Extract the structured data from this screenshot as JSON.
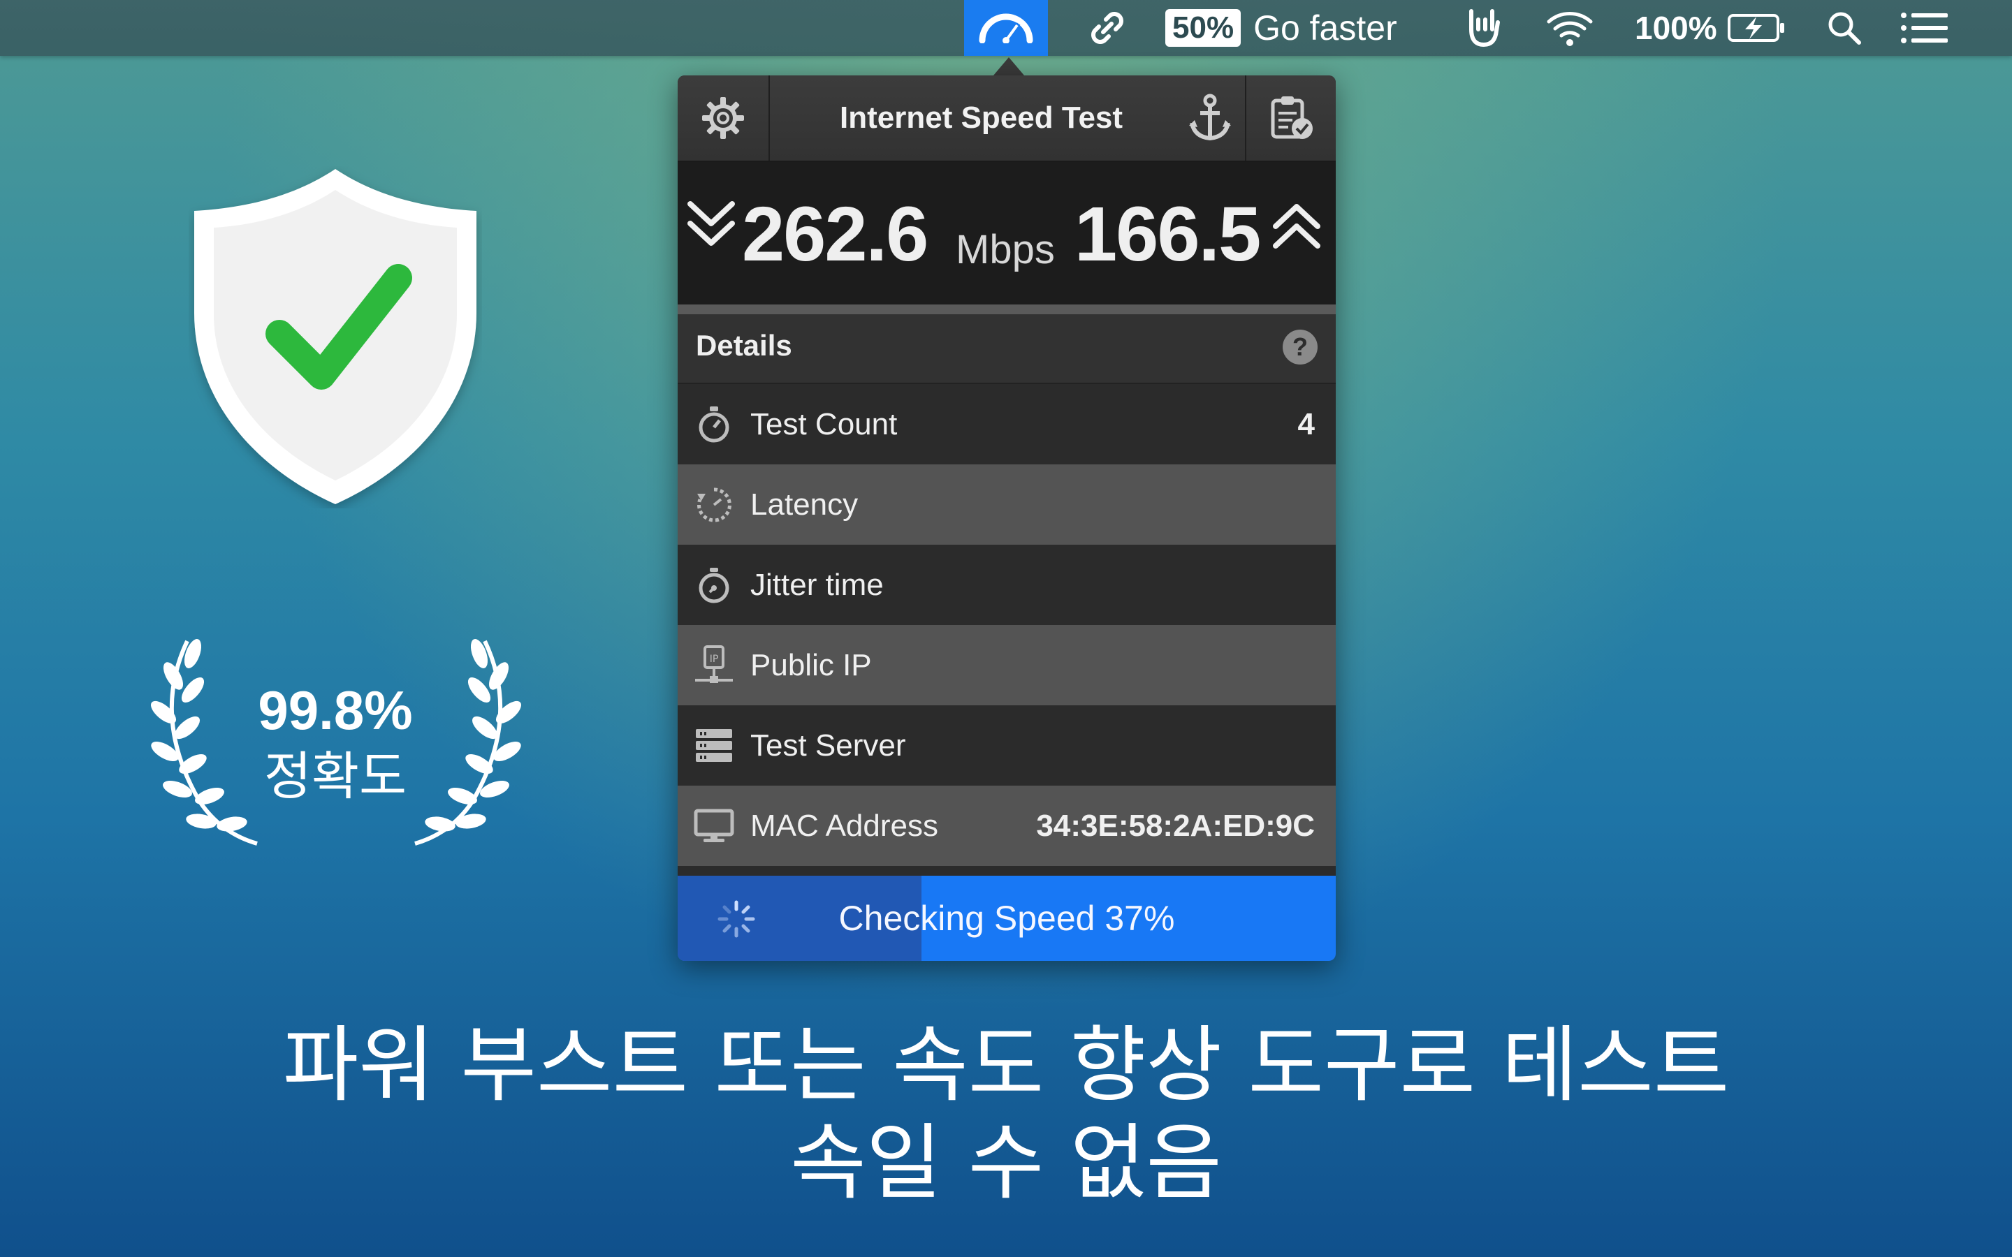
{
  "menubar": {
    "badge": "50%",
    "go_faster": "Go faster",
    "battery_percent": "100%"
  },
  "panel": {
    "title": "Internet Speed Test",
    "download": "262.6",
    "unit": "Mbps",
    "upload": "166.5",
    "details_label": "Details",
    "help": "?",
    "rows": [
      {
        "label": "Test Count",
        "value": "4",
        "icon": "stopwatch-icon"
      },
      {
        "label": "Latency",
        "value": "",
        "icon": "latency-gauge-icon"
      },
      {
        "label": "Jitter time",
        "value": "",
        "icon": "timer-icon"
      },
      {
        "label": "Public IP",
        "value": "",
        "icon": "ip-network-icon"
      },
      {
        "label": "Test Server",
        "value": "",
        "icon": "server-icon"
      },
      {
        "label": "MAC Address",
        "value": "34:3E:58:2A:ED:9C",
        "icon": "monitor-icon"
      }
    ],
    "status": "Checking Speed 37%",
    "progress": 0.37
  },
  "decor": {
    "accuracy_pct": "99.8%",
    "accuracy_label": "정확도"
  },
  "caption": {
    "line1": "파워 부스트 또는 속도 향상 도구로 테스트",
    "line2": "속일 수 없음"
  },
  "colors": {
    "accent": "#1878f5",
    "progress_fill": "#2158b4",
    "shield_check": "#2db83d"
  }
}
